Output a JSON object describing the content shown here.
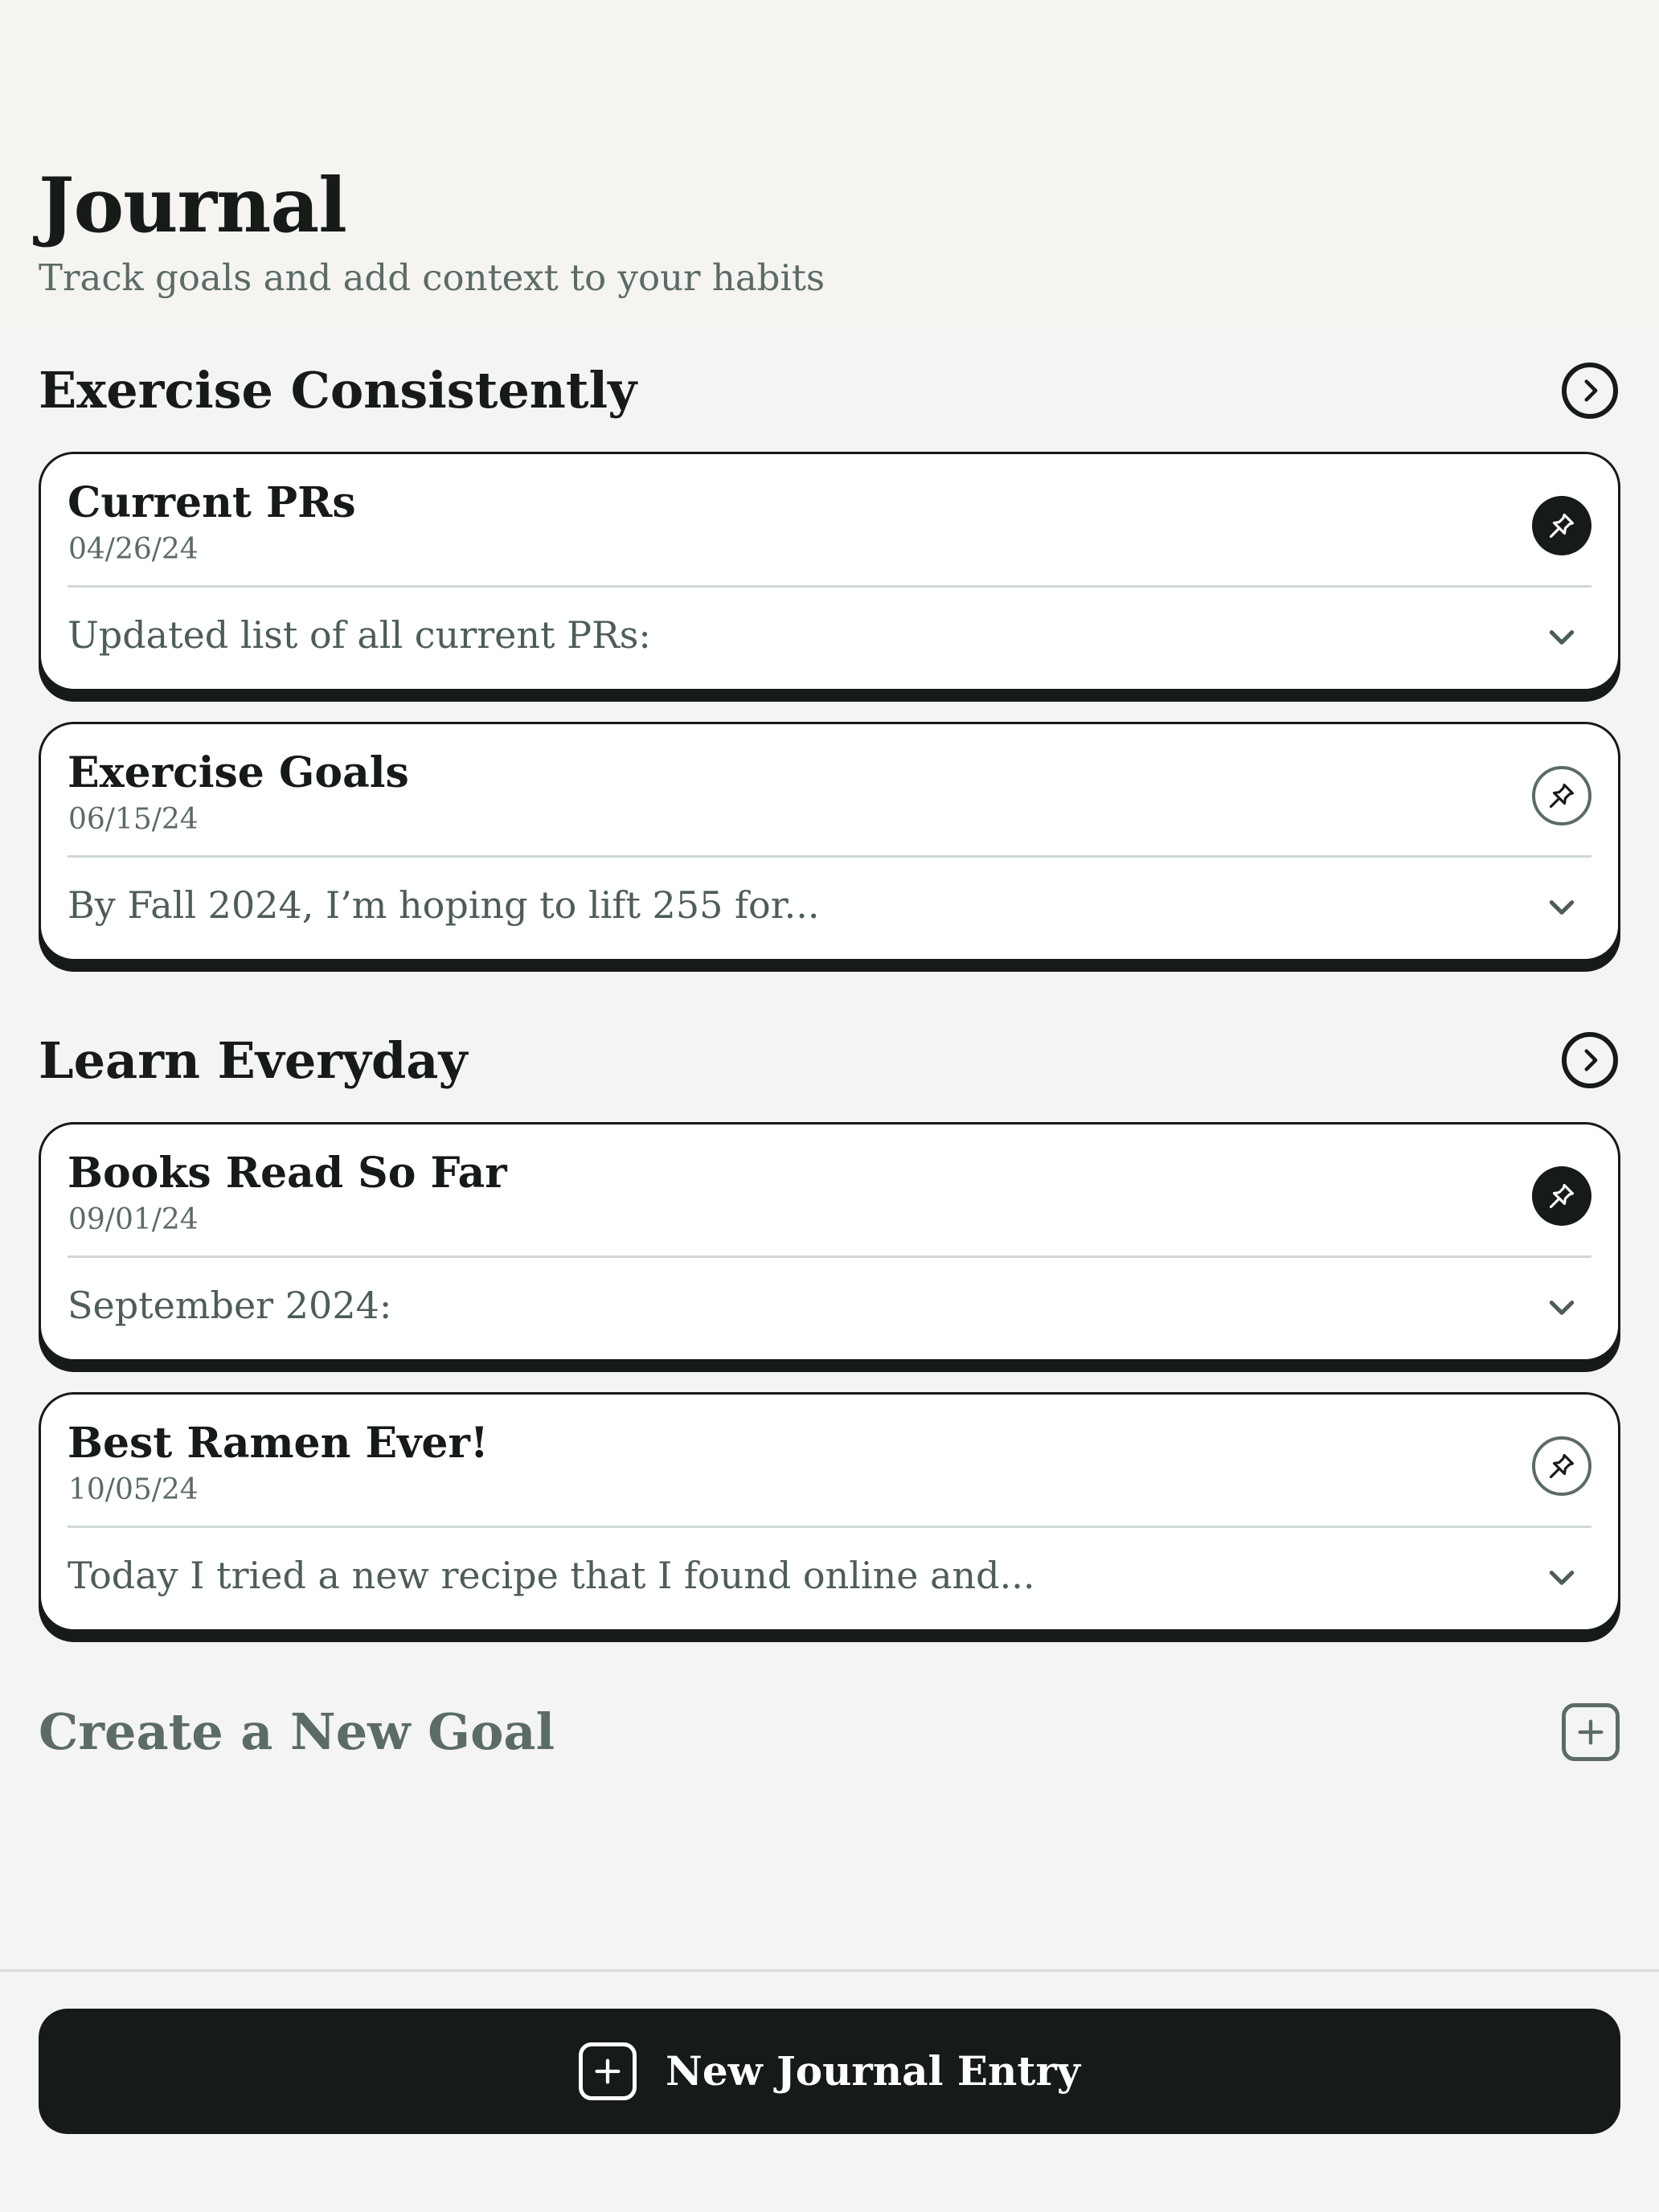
{
  "header": {
    "title": "Journal",
    "subtitle": "Track goals and add context to your habits"
  },
  "goals": [
    {
      "title": "Exercise Consistently",
      "nav_icon": "chevron-right-circle-icon",
      "entries": [
        {
          "title": "Current PRs",
          "date": "04/26/24",
          "preview": "Updated list of all current PRs:",
          "pinned": true
        },
        {
          "title": "Exercise Goals",
          "date": "06/15/24",
          "preview": "By Fall 2024, I’m hoping to lift 255 for...",
          "pinned": false
        }
      ]
    },
    {
      "title": "Learn Everyday",
      "nav_icon": "chevron-right-circle-icon",
      "entries": [
        {
          "title": "Books Read So Far",
          "date": "09/01/24",
          "preview": "September 2024:",
          "pinned": true
        },
        {
          "title": "Best Ramen Ever!",
          "date": "10/05/24",
          "preview": "Today I tried a new recipe that I found online and...",
          "pinned": false
        }
      ]
    }
  ],
  "create_goal": {
    "label": "Create a New Goal",
    "icon": "plus-square-icon"
  },
  "new_entry": {
    "label": "New Journal Entry",
    "icon": "plus-square-icon"
  },
  "colors": {
    "background": "#f4f4f2",
    "ink": "#161a19",
    "muted": "#5b6b66",
    "card": "#ffffff",
    "divider": "#cfd8d5"
  }
}
